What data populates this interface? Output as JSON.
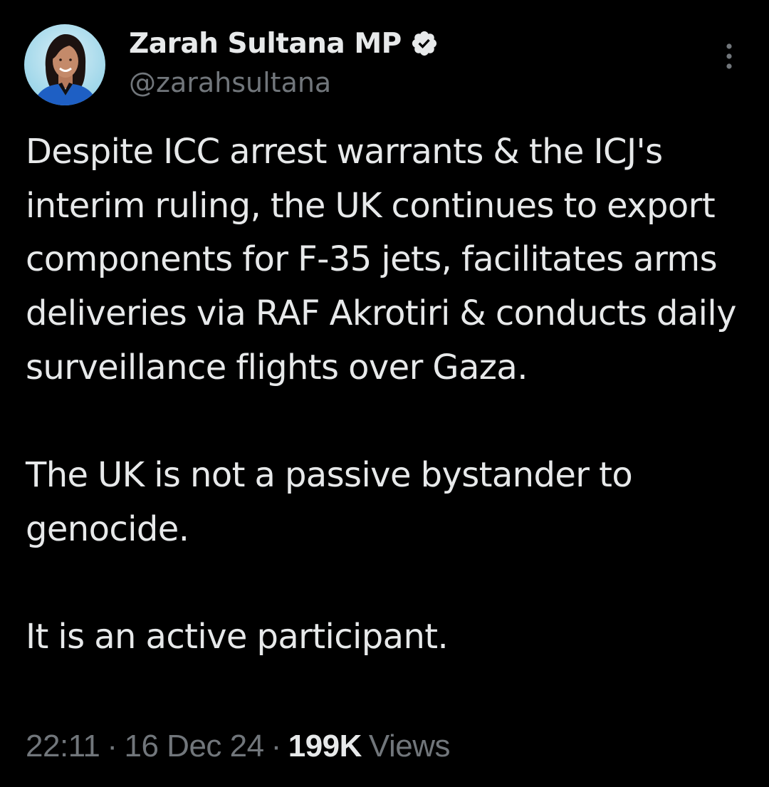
{
  "author": {
    "display_name": "Zarah Sultana MP",
    "handle": "@zarahsultana",
    "verified": true,
    "verified_color": "#e7e9ea"
  },
  "tweet": {
    "paragraphs": [
      "Despite ICC arrest warrants & the ICJ's interim ruling, the UK continues to export components for F-35 jets, facilitates arms deliveries via RAF Akrotiri & conducts daily surveillance flights over Gaza.",
      "The UK is not a passive bystander to genocide.",
      "It is an active participant."
    ]
  },
  "meta": {
    "time": "22:11",
    "separator": "·",
    "date": "16 Dec 24",
    "views_count": "199K",
    "views_label": "Views"
  },
  "icons": {
    "more": "more-vertical-icon",
    "verified": "verified-badge-icon"
  },
  "colors": {
    "background": "#000000",
    "primary_text": "#e7e9ea",
    "secondary_text": "#71767b"
  }
}
